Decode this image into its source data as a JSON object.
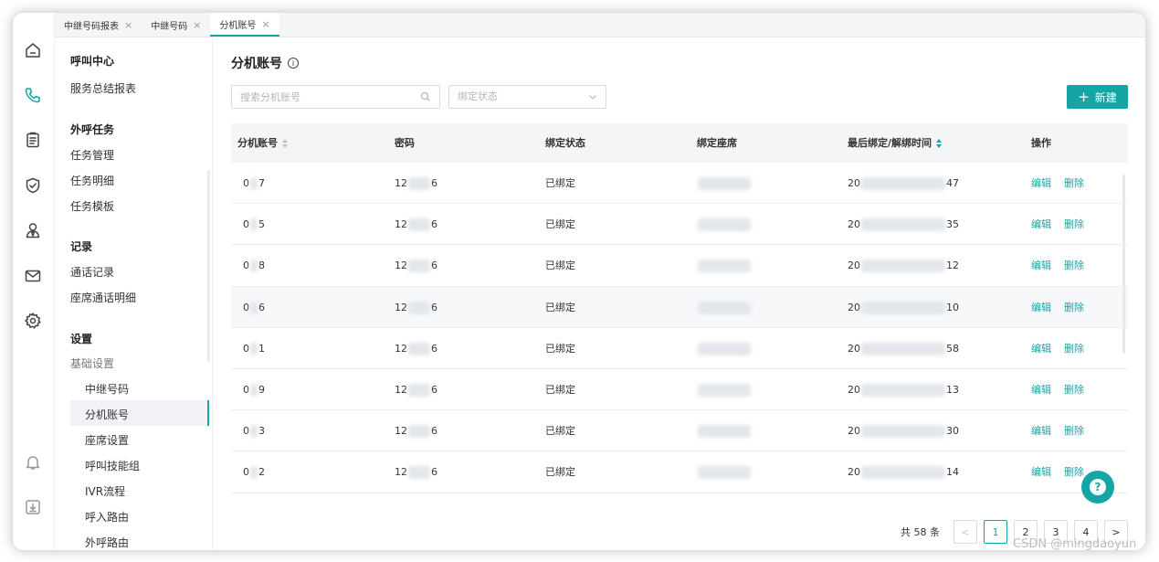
{
  "tabs": [
    {
      "label": "中继号码报表"
    },
    {
      "label": "中继号码"
    },
    {
      "label": "分机账号"
    }
  ],
  "rail_icons": [
    "home-icon",
    "phone-icon",
    "clipboard-icon",
    "shield-check-icon",
    "user-tie-icon",
    "mail-icon",
    "gear-icon",
    "bell-icon",
    "download-icon"
  ],
  "sidebar": {
    "sections": [
      {
        "title": "呼叫中心",
        "items": [
          "服务总结报表"
        ]
      },
      {
        "title": "外呼任务",
        "items": [
          "任务管理",
          "任务明细",
          "任务模板"
        ]
      },
      {
        "title": "记录",
        "items": [
          "通话记录",
          "座席通话明细"
        ]
      },
      {
        "title": "设置",
        "items": [
          "基础设置"
        ]
      }
    ],
    "sub_items": [
      "中继号码",
      "分机账号",
      "座席设置",
      "呼叫技能组",
      "IVR流程",
      "呼入路由",
      "外呼路由"
    ],
    "selected": "分机账号"
  },
  "page": {
    "title": "分机账号",
    "search_placeholder": "搜索分机账号",
    "status_placeholder": "绑定状态",
    "new_button": "新建"
  },
  "table": {
    "columns": [
      "分机账号",
      "密码",
      "绑定状态",
      "绑定座席",
      "最后绑定/解绑时间",
      "操作"
    ],
    "rows": [
      {
        "acc_a": "0",
        "acc_b": "7",
        "pwd_a": "12",
        "pwd_b": "6",
        "status": "已绑定",
        "time_a": "20",
        "time_b": "47",
        "edit": "编辑",
        "del": "删除"
      },
      {
        "acc_a": "0",
        "acc_b": "5",
        "pwd_a": "12",
        "pwd_b": "6",
        "status": "已绑定",
        "time_a": "20",
        "time_b": "35",
        "edit": "编辑",
        "del": "删除"
      },
      {
        "acc_a": "0",
        "acc_b": "8",
        "pwd_a": "12",
        "pwd_b": "6",
        "status": "已绑定",
        "time_a": "20",
        "time_b": "12",
        "edit": "编辑",
        "del": "删除"
      },
      {
        "acc_a": "0",
        "acc_b": "6",
        "pwd_a": "12",
        "pwd_b": "6",
        "status": "已绑定",
        "time_a": "20",
        "time_b": "10",
        "edit": "编辑",
        "del": "删除"
      },
      {
        "acc_a": "0",
        "acc_b": "1",
        "pwd_a": "12",
        "pwd_b": "6",
        "status": "已绑定",
        "time_a": "20",
        "time_b": "58",
        "edit": "编辑",
        "del": "删除"
      },
      {
        "acc_a": "0",
        "acc_b": "9",
        "pwd_a": "12",
        "pwd_b": "6",
        "status": "已绑定",
        "time_a": "20",
        "time_b": "13",
        "edit": "编辑",
        "del": "删除"
      },
      {
        "acc_a": "0",
        "acc_b": "3",
        "pwd_a": "12",
        "pwd_b": "6",
        "status": "已绑定",
        "time_a": "20",
        "time_b": "30",
        "edit": "编辑",
        "del": "删除"
      },
      {
        "acc_a": "0",
        "acc_b": "2",
        "pwd_a": "12",
        "pwd_b": "6",
        "status": "已绑定",
        "time_a": "20",
        "time_b": "14",
        "edit": "编辑",
        "del": "删除"
      }
    ]
  },
  "pagination": {
    "total": "共 58 条",
    "prev": "<",
    "pages": [
      "1",
      "2",
      "3",
      "4"
    ],
    "current": "1",
    "next": ">"
  },
  "watermark": "CSDN @mingdaoyun",
  "colors": {
    "accent": "#16a5a5"
  }
}
